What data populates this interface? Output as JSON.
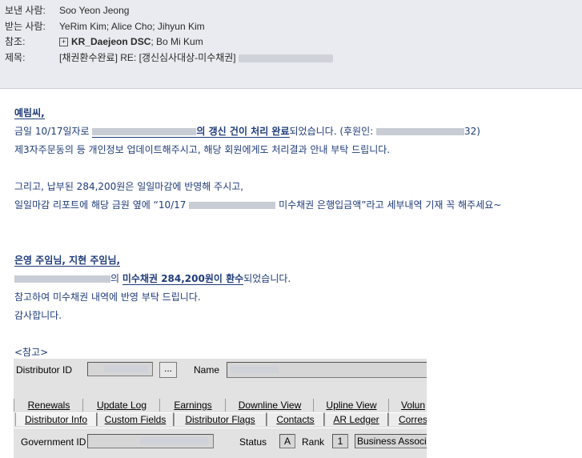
{
  "header": {
    "from_label": "보낸 사람:",
    "from_value": "Soo Yeon Jeong",
    "to_label": "받는 사람:",
    "to_value": "YeRim Kim; Alice Cho; Jihyun Kim",
    "cc_label": "참조:",
    "cc_group": "KR_Daejeon DSC",
    "cc_rest": "; Bo Mi Kum",
    "subject_label": "제목:",
    "subject_value": "[채권환수완료] RE: [갱신심사대상-미수채권]"
  },
  "body": {
    "greet1": "예림씨,",
    "l2_a": "금일 10/17일자로 ",
    "l2_b": "의 갱신 건이 처리 완료",
    "l2_c": "되었습니다. (후원인: ",
    "l2_d": "32)",
    "l3": "제3자주문동의 등 개인정보 업데이트해주시고, 해당 회원에게도 처리결과 안내 부탁 드립니다.",
    "l4": "그리고, 납부된 284,200원은 일일마감에 반영해 주시고,",
    "l5_a": "일일마감 리포트에 해당 금원 옆에 “10/17 ",
    "l5_b": " 미수채권 은행입금액”라고 세부내역 기재 꼭 해주세요~",
    "greet2": "은영 주임님, 지현 주임님,",
    "l7_b": "미수채권 284,200원이 환수",
    "l7_c": "되었습니다.",
    "l8": "참고하여 미수채권 내역에 반영 부탁 드립니다.",
    "l9": "감사합니다.",
    "ref": "<참고>"
  },
  "panel": {
    "distributor_id_label": "Distributor ID",
    "dots_label": "...",
    "name_label": "Name",
    "tabs_row1": [
      "Renewals",
      "Update Log",
      "Earnings",
      "Downline View",
      "Upline View",
      "Volun"
    ],
    "tabs_row2": [
      "Distributor Info",
      "Custom Fields",
      "Distributor Flags",
      "Contacts",
      "AR Ledger",
      "Corres"
    ],
    "gov_id_label": "Government ID",
    "status_label": "Status",
    "status_value": "A",
    "rank_label": "Rank",
    "rank_value": "1",
    "rank_desc": "Business Associa"
  }
}
